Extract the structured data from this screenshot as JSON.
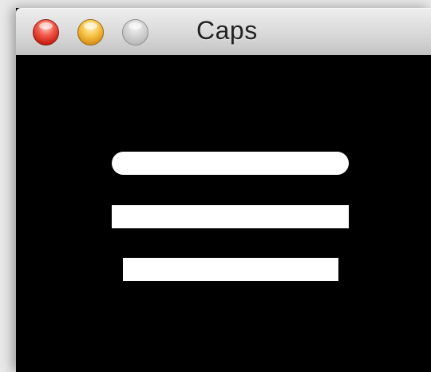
{
  "window": {
    "title": "Caps"
  },
  "traffic_lights": {
    "close": "close-button",
    "minimize": "minimize-button",
    "zoom": "zoom-button"
  },
  "canvas": {
    "background": "#000000",
    "stroke_color": "#ffffff",
    "lines": [
      {
        "cap": "round"
      },
      {
        "cap": "square"
      },
      {
        "cap": "butt"
      }
    ]
  }
}
